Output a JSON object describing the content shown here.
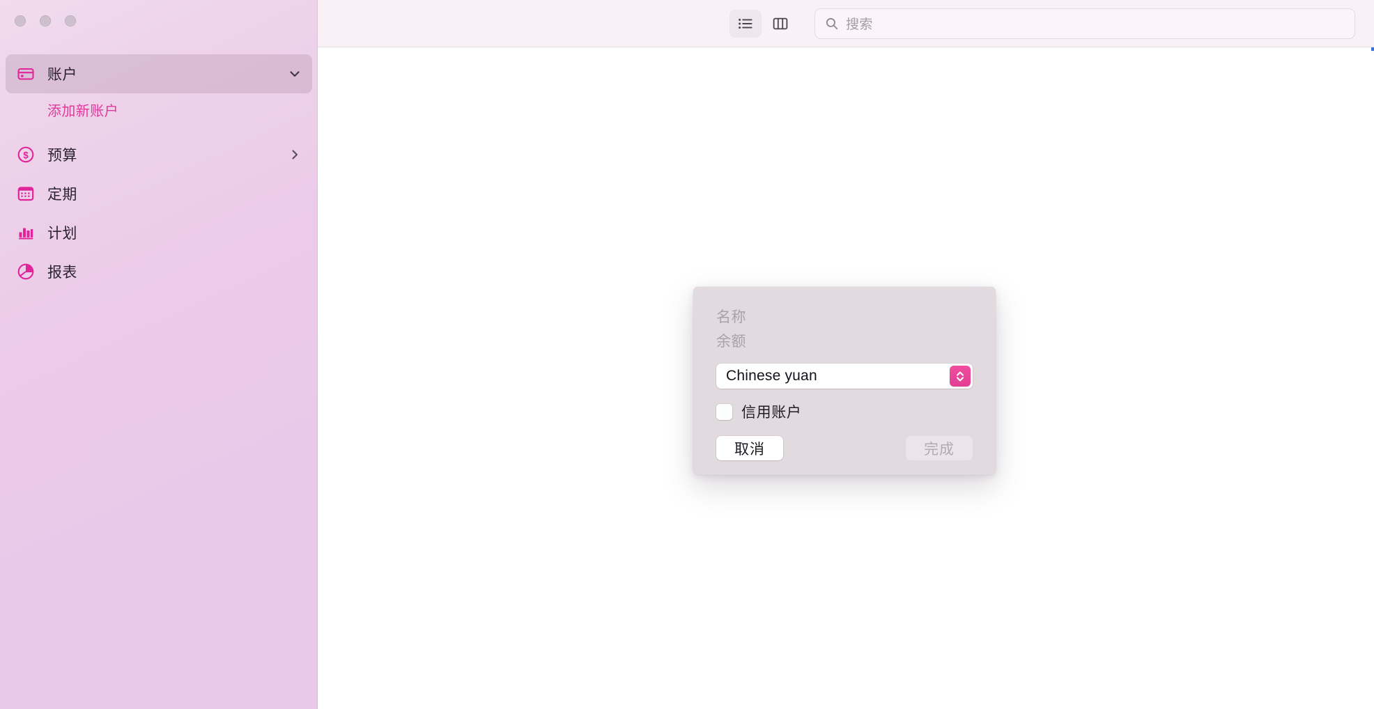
{
  "window": {
    "traffic_lights": [
      "close",
      "minimize",
      "zoom"
    ]
  },
  "sidebar": {
    "items": [
      {
        "label": "账户",
        "icon": "credit-card-icon",
        "selected": true,
        "chevron": "chevron-down-icon"
      },
      {
        "label": "添加新账户",
        "icon": "none",
        "sub": true
      },
      {
        "label": "预算",
        "icon": "dollar-circle-icon",
        "selected": false,
        "chevron": "chevron-right-icon"
      },
      {
        "label": "定期",
        "icon": "calendar-icon",
        "selected": false,
        "chevron": "none"
      },
      {
        "label": "计划",
        "icon": "bar-chart-icon",
        "selected": false,
        "chevron": "none"
      },
      {
        "label": "报表",
        "icon": "pie-chart-icon",
        "selected": false,
        "chevron": "none"
      }
    ]
  },
  "toolbar": {
    "list_view_icon": "list-view-icon",
    "column_view_icon": "column-view-icon",
    "search": {
      "placeholder": "搜索",
      "value": "",
      "icon": "search-icon"
    }
  },
  "dialog": {
    "name_placeholder": "名称",
    "balance_placeholder": "余额",
    "currency": {
      "selected": "Chinese yuan",
      "stepper_icon": "stepper-updown-icon"
    },
    "credit_account": {
      "label": "信用账户",
      "checked": false
    },
    "cancel_label": "取消",
    "done_label": "完成",
    "done_enabled": false
  },
  "colors": {
    "accent_pink": "#e23d93",
    "sidebar_gradient_start": "#f0dced",
    "sidebar_gradient_end": "#e8c9ea",
    "dialog_bg": "#e1dade",
    "toolbar_bg": "#f9f1f6"
  }
}
